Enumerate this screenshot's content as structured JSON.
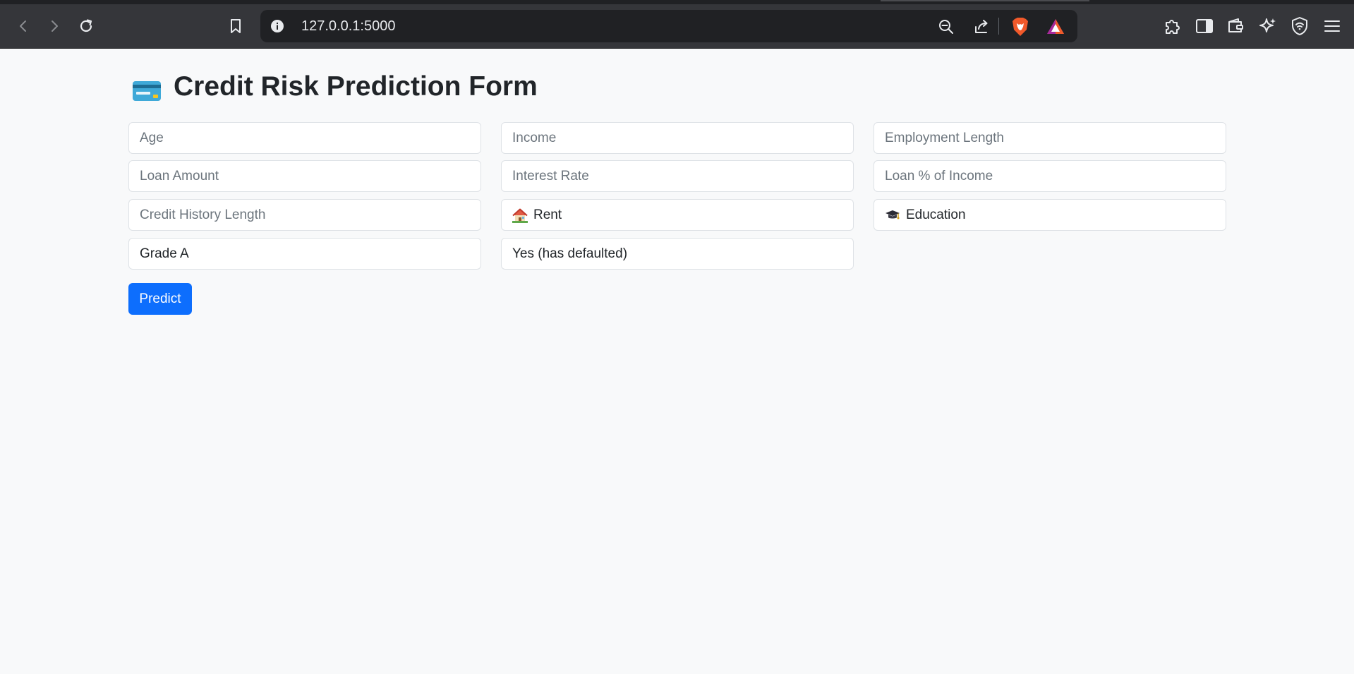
{
  "browser": {
    "url": "127.0.0.1:5000",
    "icons": [
      "back-icon",
      "forward-icon",
      "reload-icon",
      "bookmark-icon",
      "site-info-icon",
      "zoom-out-icon",
      "share-icon",
      "brave-shields-icon",
      "brave-rewards-icon",
      "extensions-icon",
      "sidebar-icon",
      "wallet-icon",
      "leo-ai-icon",
      "vpn-icon",
      "menu-icon"
    ]
  },
  "page": {
    "title": "Credit Risk Prediction Form",
    "title_icon": "credit-card-icon"
  },
  "form": {
    "age_placeholder": "Age",
    "income_placeholder": "Income",
    "employment_length_placeholder": "Employment Length",
    "loan_amount_placeholder": "Loan Amount",
    "interest_rate_placeholder": "Interest Rate",
    "loan_percent_income_placeholder": "Loan % of Income",
    "credit_history_length_placeholder": "Credit History Length",
    "home_ownership": {
      "value": "Rent",
      "icon": "house-icon"
    },
    "loan_intent": {
      "value": "Education",
      "icon": "graduation-cap-icon"
    },
    "loan_grade": {
      "value": "Grade A"
    },
    "default_on_file": {
      "value": "Yes (has defaulted)"
    },
    "submit_label": "Predict"
  },
  "colors": {
    "page_bg": "#f8f9fa",
    "primary": "#0d6efd",
    "chrome": "#35363a",
    "urlbar": "#202124"
  }
}
